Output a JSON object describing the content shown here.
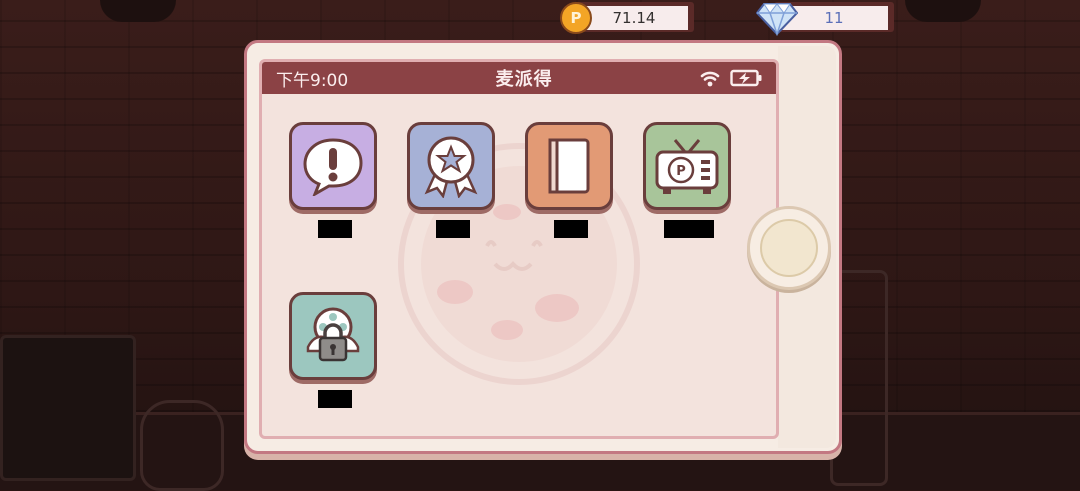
{
  "hud": {
    "coins": "71.14",
    "gems": "11"
  },
  "phone": {
    "status_time": "下午9:00",
    "status_title": "麦派得"
  },
  "apps": [
    {
      "icon": "exclamation-bubble-icon",
      "label": "",
      "tile_color": "#c7aee3"
    },
    {
      "icon": "award-ribbon-icon",
      "label": "",
      "tile_color": "#a6b1d6"
    },
    {
      "icon": "book-icon",
      "label": "",
      "tile_color": "#e29a75"
    },
    {
      "icon": "tv-icon",
      "label": "",
      "tile_color": "#a8c59a"
    },
    {
      "icon": "locked-film-icon",
      "label": "",
      "tile_color": "#9cc7bf"
    }
  ],
  "colors": {
    "status_bar": "#8b4245",
    "screen_bg": "#f3e3dd",
    "frame_border": "#c37882"
  }
}
